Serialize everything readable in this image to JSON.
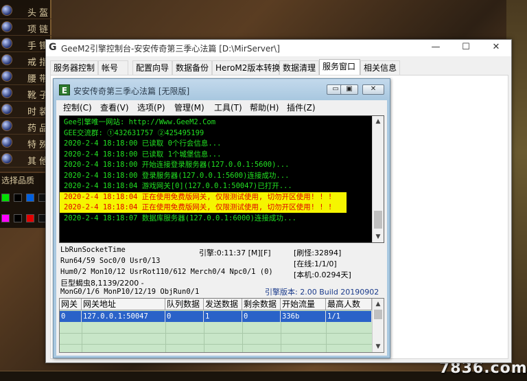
{
  "game": {
    "left_panel_items": [
      "头 盔",
      "项 链",
      "手 镯",
      "戒 指",
      "腰 带",
      "靴 子",
      "时 装",
      "药 品",
      "特 殊",
      "其 他"
    ],
    "color_picker_label": "选择品质",
    "watermark": "7836.com"
  },
  "main_window": {
    "logo": "G",
    "title": "GeeM2引擎控制台-安安传奇第三季心法篇 [D:\\MirServer\\]",
    "minimize": "—",
    "maximize": "☐",
    "close": "✕",
    "tabs": [
      "服务器控制",
      "帐号",
      "配置向导",
      "数据备份",
      "HeroM2版本转换",
      "数据清理",
      "服务窗口",
      "相关信息"
    ],
    "active_tab": "服务窗口"
  },
  "inner_window": {
    "logo": "E",
    "title": "安安传奇第三季心法篇 [无限版]",
    "btn_min": "▭",
    "btn_max": "▣",
    "btn_close": "✕",
    "menu": [
      "控制(C)",
      "查看(V)",
      "选项(P)",
      "管理(M)",
      "工具(T)",
      "帮助(H)",
      "插件(Z)"
    ]
  },
  "log": {
    "lines": [
      {
        "text": "Gee引擎唯一网站: http://Www.GeeM2.Com",
        "type": "normal"
      },
      {
        "text": "GEE交流群: ①432631757   ②425495199",
        "type": "normal"
      },
      {
        "text": "2020-2-4 18:18:00 已读取 0个行会信息...",
        "type": "normal"
      },
      {
        "text": "2020-2-4 18:18:00 已读取 1个城堡信息...",
        "type": "normal"
      },
      {
        "text": "2020-2-4 18:18:00 开始连接登录服务器(127.0.0.1:5600)...",
        "type": "normal"
      },
      {
        "text": "2020-2-4 18:18:00 登录服务器(127.0.0.1:5600)连接成功...",
        "type": "normal"
      },
      {
        "text": "2020-2-4 18:18:04 游戏网关[0](127.0.0.1:50047)已打开...",
        "type": "normal"
      },
      {
        "text": "2020-2-4 18:18:04 正在使用免费版网关, 仅限测试使用, 切勿开区使用! ! !",
        "type": "warn"
      },
      {
        "text": "2020-2-4 18:18:04 正在使用免费版网关, 仅限测试使用, 切勿开区使用! ! !",
        "type": "warn"
      },
      {
        "text": "2020-2-4 18:18:07 数据库服务器(127.0.0.1:6000)连接成功...",
        "type": "normal"
      }
    ],
    "colors": {
      "normal": "#22e022",
      "warn_text": "#e00000",
      "warn_bg": "#f5f500"
    }
  },
  "status": {
    "socket_label": "LbRunSocketTime",
    "run": "Run64/59 Soc0/0 Usr0/13",
    "hum": "Hum0/2 Mon10/12 UsrRot110/612 Merch0/4 Npc0/1 (0)",
    "mon_big": "巨型蝎虫8,1139/2200 -",
    "mon_gen": "MonG0/1/6 MonP10/12/19 ObjRun0/1",
    "engine_time": "引擎:0:11:37 [M][F]",
    "refresh": "[刷怪:32894]",
    "online": "[在线:1/1/0]",
    "local": "[本机:0.0294天]",
    "version": "引擎版本: 2.00 Build 20190902"
  },
  "gateway_table": {
    "headers": [
      "网关",
      "网关地址",
      "队列数据",
      "发送数据",
      "剩余数据",
      "开始流量",
      "最高人数"
    ],
    "rows": [
      [
        "0",
        "127.0.0.1:50047",
        "0",
        "1",
        "0",
        "336b",
        "1/1"
      ]
    ]
  }
}
